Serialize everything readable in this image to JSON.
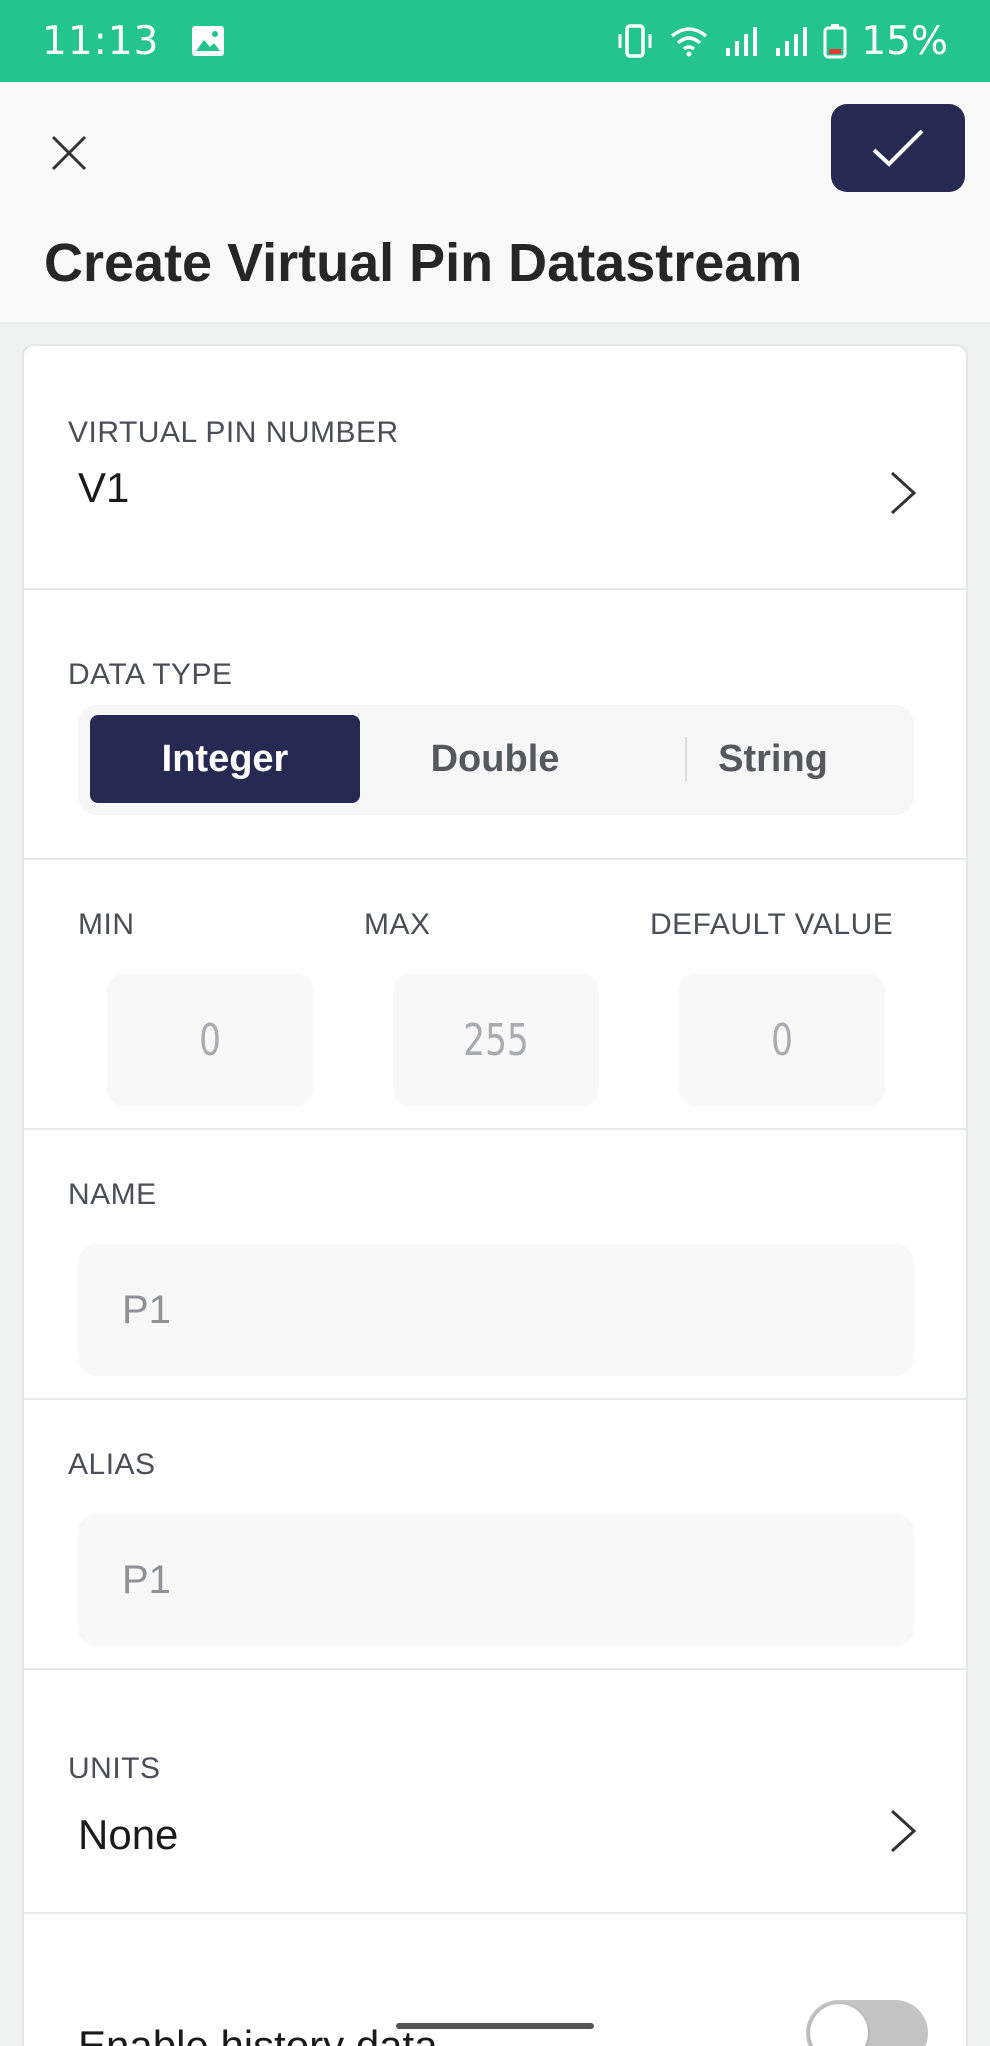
{
  "status_bar": {
    "time": "11:13",
    "battery": "15%",
    "icons": [
      "gallery-icon",
      "vibrate-icon",
      "wifi-icon",
      "signal-icon",
      "signal-icon",
      "battery-icon"
    ]
  },
  "header": {
    "title": "Create Virtual Pin Datastream",
    "close_icon": "close-icon",
    "confirm_icon": "checkmark-icon"
  },
  "virtual_pin": {
    "label": "VIRTUAL PIN NUMBER",
    "value": "V1"
  },
  "data_type": {
    "label": "DATA TYPE",
    "options": [
      "Integer",
      "Double",
      "String"
    ],
    "selected": "Integer"
  },
  "range": {
    "min_label": "MIN",
    "min_value": "0",
    "max_label": "MAX",
    "max_value": "255",
    "default_label": "DEFAULT VALUE",
    "default_value": "0"
  },
  "name": {
    "label": "NAME",
    "value": "P1"
  },
  "alias": {
    "label": "ALIAS",
    "value": "P1"
  },
  "units": {
    "label": "UNITS",
    "value": "None"
  },
  "history": {
    "label": "Enable history data",
    "enabled": false
  },
  "colors": {
    "status_bar": "#23c48e",
    "primary": "#262a52",
    "card_bg": "#ffffff",
    "field_bg": "#f8f8f8"
  }
}
